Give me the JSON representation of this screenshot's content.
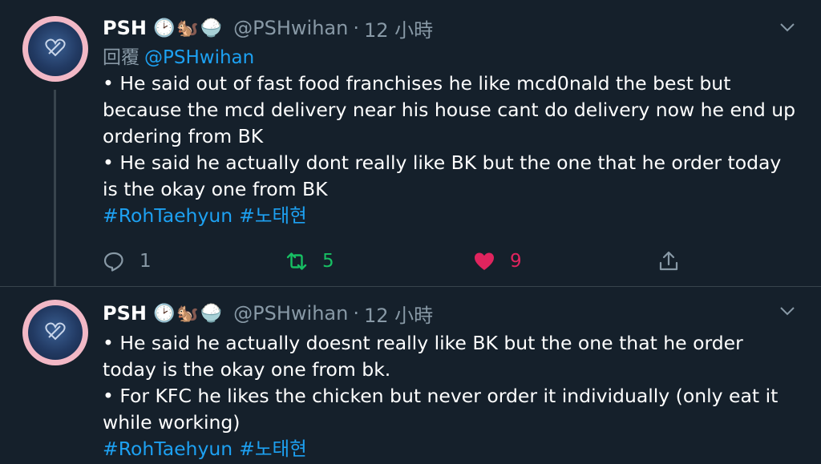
{
  "tweets": [
    {
      "display_name": "PSH",
      "emojis": "🕑🐿️🍚",
      "handle": "@PSHwihan",
      "separator": "·",
      "time": "12 小時",
      "reply_prefix": "回覆",
      "reply_to": "@PSHwihan",
      "text": "• He said out of fast food franchises he like mcd0nald the best but\nbecause the mcd delivery near his house cant do delivery now he end up\nordering from BK\n• He said he actually dont really like BK but the one that he order today\nis the okay one from BK",
      "hashtags": [
        "#RohTaehyun",
        "#노태현"
      ],
      "counts": {
        "replies": "1",
        "retweets": "5",
        "likes": "9"
      },
      "liked": true,
      "retweeted": true
    },
    {
      "display_name": "PSH",
      "emojis": "🕑🐿️🍚",
      "handle": "@PSHwihan",
      "separator": "·",
      "time": "12 小時",
      "text": "• He said he actually doesnt really like BK but the one that he order\ntoday is the okay one from bk.\n• For KFC he likes the chicken but never order it individually (only eat it\nwhile working)",
      "hashtags": [
        "#RohTaehyun",
        "#노태현"
      ]
    }
  ],
  "colors": {
    "background": "#15202b",
    "divider": "#38444d",
    "secondary_text": "#8899a6",
    "link": "#1da1f2",
    "retweet": "#17bf63",
    "like": "#e0245e"
  },
  "icons": [
    "chevron-down-icon",
    "reply-icon",
    "retweet-icon",
    "heart-icon",
    "share-icon"
  ]
}
